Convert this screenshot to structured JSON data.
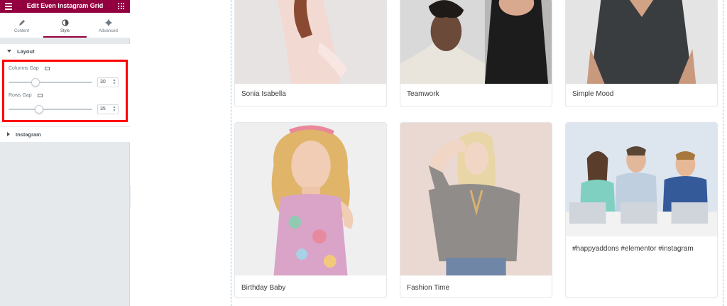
{
  "panel": {
    "title": "Edit Even Instagram Grid",
    "tabs": [
      {
        "label": "Content",
        "icon": "pencil-icon"
      },
      {
        "label": "Style",
        "icon": "contrast-icon"
      },
      {
        "label": "Advanced",
        "icon": "gear-icon"
      }
    ],
    "layout_section": {
      "title": "Layout",
      "columns_gap": {
        "label": "Columns Gap",
        "value": "30",
        "level": 0.3
      },
      "rows_gap": {
        "label": "Rows Gap",
        "value": "35",
        "level": 0.35
      }
    },
    "instagram_section": {
      "title": "Instagram"
    },
    "accent": "#93003f"
  },
  "cards": [
    {
      "caption": "Sonia Isabella"
    },
    {
      "caption": "Teamwork"
    },
    {
      "caption": "Simple Mood"
    },
    {
      "caption": "Birthday Baby"
    },
    {
      "caption": "Fashion Time"
    },
    {
      "caption": "#happyaddons #elementor #instagram"
    }
  ]
}
